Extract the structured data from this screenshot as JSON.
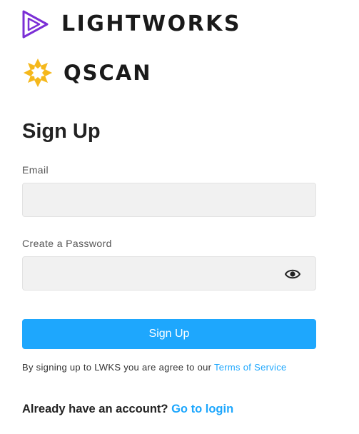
{
  "logos": {
    "lightworks": {
      "name": "LIGHTWORKS",
      "color": "#7b2fd6"
    },
    "qscan": {
      "name": "QSCAN",
      "color": "#f5b81c"
    }
  },
  "form": {
    "title": "Sign Up",
    "email": {
      "label": "Email",
      "value": "",
      "placeholder": ""
    },
    "password": {
      "label": "Create a Password",
      "value": "",
      "placeholder": "",
      "toggle_icon": "eye-icon"
    },
    "submit_label": "Sign Up"
  },
  "terms": {
    "text": "By signing up to LWKS you are agree to our",
    "link_label": "Terms of Service"
  },
  "login": {
    "prompt": "Already have an account?",
    "link_label": "Go to login"
  },
  "colors": {
    "accent": "#1ea7fd",
    "input_bg": "#f1f1f1"
  }
}
